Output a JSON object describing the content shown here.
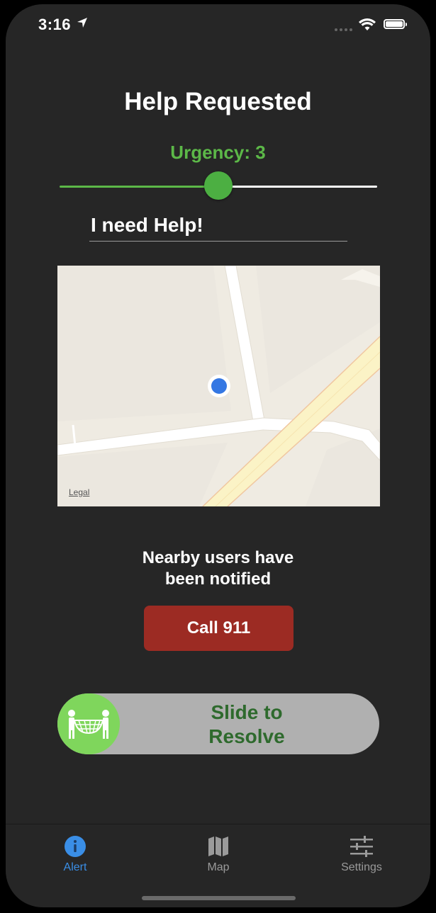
{
  "status_bar": {
    "time": "3:16"
  },
  "header": {
    "title": "Help Requested"
  },
  "urgency": {
    "label": "Urgency: 3",
    "value": 3,
    "min": 1,
    "max": 5
  },
  "message": {
    "value": "I need Help!"
  },
  "map": {
    "legal_label": "Legal"
  },
  "notice": {
    "line1": "Nearby users have",
    "line2": "been notified"
  },
  "call_button": {
    "label": "Call 911"
  },
  "resolve_slider": {
    "line1": "Slide to",
    "line2": "Resolve"
  },
  "tabs": [
    {
      "label": "Alert",
      "icon": "info-icon",
      "active": true
    },
    {
      "label": "Map",
      "icon": "map-icon",
      "active": false
    },
    {
      "label": "Settings",
      "icon": "sliders-icon",
      "active": false
    }
  ],
  "colors": {
    "background": "#262626",
    "accent_green": "#5cb848",
    "call_red": "#9c2b23",
    "resolve_text": "#2e6a2d",
    "tab_active": "#3a8ee6"
  }
}
